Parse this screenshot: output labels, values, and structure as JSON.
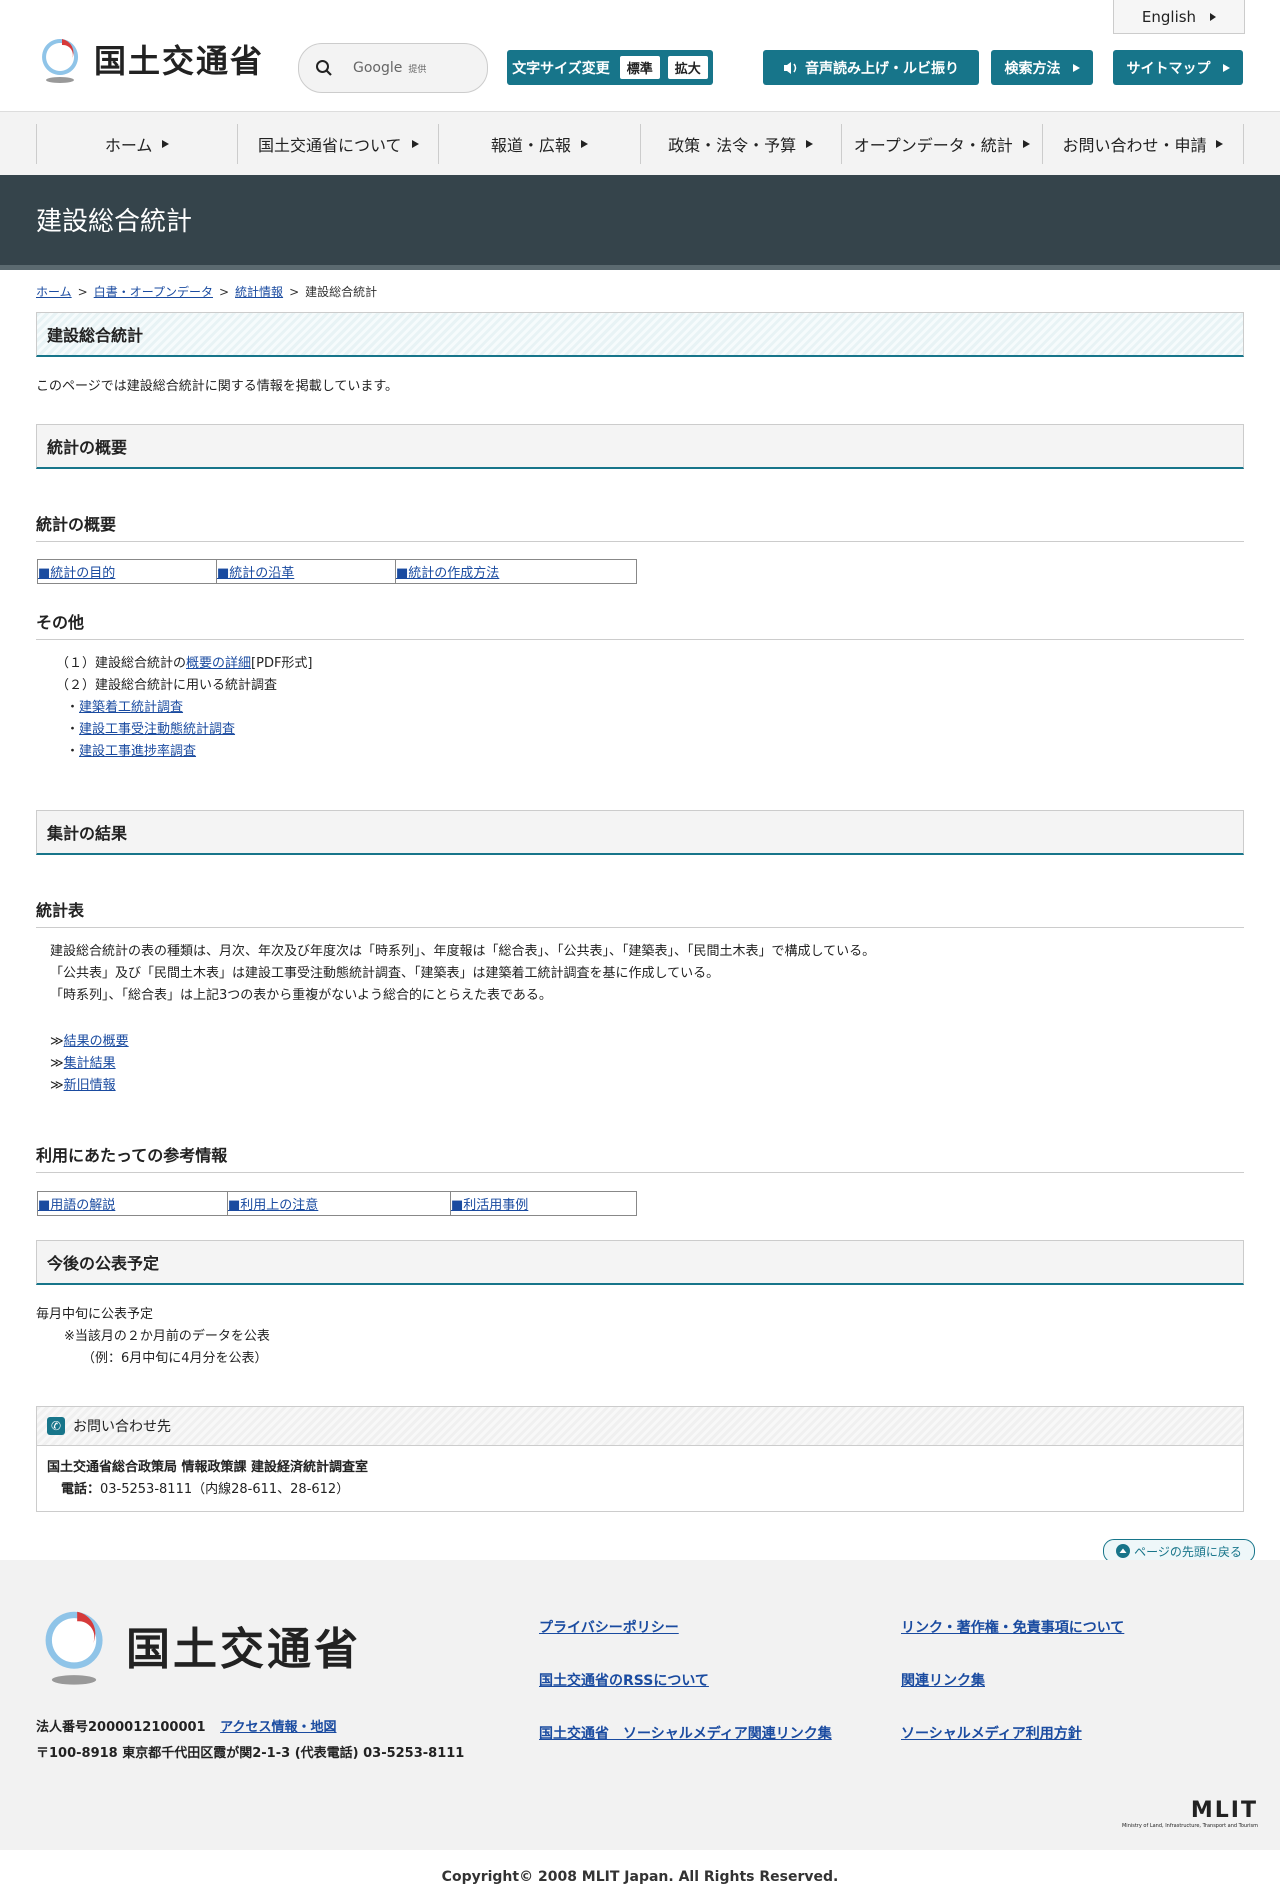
{
  "header": {
    "org_name": "国土交通省",
    "english_label": "English",
    "search_placeholder": "Google",
    "search_provider": "提供",
    "font_size_label": "文字サイズ変更",
    "font_standard": "標準",
    "font_large": "拡大",
    "speech_label": "音声読み上げ・ルビ振り",
    "search_method_label": "検索方法",
    "sitemap_label": "サイトマップ",
    "accent_color": "#17758a"
  },
  "nav": {
    "items": [
      "ホーム",
      "国土交通省について",
      "報道・広報",
      "政策・法令・予算",
      "オープンデータ・統計",
      "お問い合わせ・申請"
    ]
  },
  "page": {
    "title": "建設総合統計",
    "breadcrumb": [
      "ホーム",
      "白書・オープンデータ",
      "統計情報",
      "建設総合統計"
    ],
    "section_title": "建設総合統計",
    "intro": "このページでは建設総合統計に関する情報を掲載しています。"
  },
  "overview": {
    "heading": "統計の概要",
    "subheading": "統計の概要",
    "links": [
      "■統計の目的",
      "■統計の沿革",
      "■統計の作成方法"
    ],
    "other_heading": "その他",
    "item1_prefix": "（１）建設総合統計の",
    "item1_link": "概要の詳細",
    "item1_suffix": "[PDF形式]",
    "item2": "（２）建設総合統計に用いる統計調査",
    "surveys": [
      "建築着工統計調査",
      "建設工事受注動態統計調査",
      "建設工事進捗率調査"
    ],
    "bullet": "・"
  },
  "results": {
    "heading": "集計の結果",
    "subheading": "統計表",
    "para1": "建設総合統計の表の種類は、月次、年次及び年度次は「時系列」、年度報は「総合表」、「公共表」、「建築表」、「民間土木表」で構成している。",
    "para2": "「公共表」及び「民間土木表」は建設工事受注動態統計調査、「建築表」は建築着工統計調査を基に作成している。",
    "para3": "「時系列」、「総合表」は上記3つの表から重複がないよう総合的にとらえた表である。",
    "arrow": "≫",
    "links": [
      "結果の概要",
      "集計結果",
      "新旧情報"
    ],
    "ref_heading": "利用にあたっての参考情報",
    "ref_links": [
      "■用語の解説",
      "■利用上の注意",
      "■利活用事例"
    ]
  },
  "schedule": {
    "heading": "今後の公表予定",
    "line1": "毎月中旬に公表予定",
    "line2": "※当該月の２か月前のデータを公表",
    "line3": "（例：6月中旬に4月分を公表）"
  },
  "contact": {
    "heading": "お問い合わせ先",
    "dept": "国土交通省総合政策局 情報政策課 建設経済統計調査室",
    "tel_label": "電話：",
    "tel": "03-5253-8111（内線28-611、28-612）"
  },
  "to_top": "ページの先頭に戻る",
  "footer": {
    "org_name": "国土交通省",
    "corp_number": "法人番号2000012100001",
    "access_link": "アクセス情報・地図",
    "address": "〒100-8918 東京都千代田区霞が関2-1-3 (代表電話) 03-5253-8111",
    "links_col1": [
      "プライバシーポリシー",
      "国土交通省のRSSについて",
      "国土交通省　ソーシャルメディア関連リンク集"
    ],
    "links_col2": [
      "リンク・著作権・免責事項について",
      "関連リンク集",
      "ソーシャルメディア利用方針"
    ],
    "mlit_logo": "MLIT",
    "mlit_sub": "Ministry of Land, Infrastructure, Transport and Tourism",
    "copyright": "Copyright© 2008 MLIT Japan. All Rights Reserved."
  }
}
